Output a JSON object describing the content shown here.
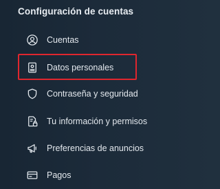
{
  "section": {
    "title": "Configuración de cuentas"
  },
  "menu": {
    "items": [
      {
        "label": "Cuentas",
        "icon": "user-circle-icon"
      },
      {
        "label": "Datos personales",
        "icon": "id-card-icon"
      },
      {
        "label": "Contraseña y seguridad",
        "icon": "shield-icon"
      },
      {
        "label": "Tu información y permisos",
        "icon": "document-lock-icon"
      },
      {
        "label": "Preferencias de anuncios",
        "icon": "megaphone-icon"
      },
      {
        "label": "Pagos",
        "icon": "credit-card-icon"
      }
    ]
  },
  "colors": {
    "background": "#1c2b3a",
    "text": "#e4e9ee",
    "highlight_border": "#e0262e"
  }
}
